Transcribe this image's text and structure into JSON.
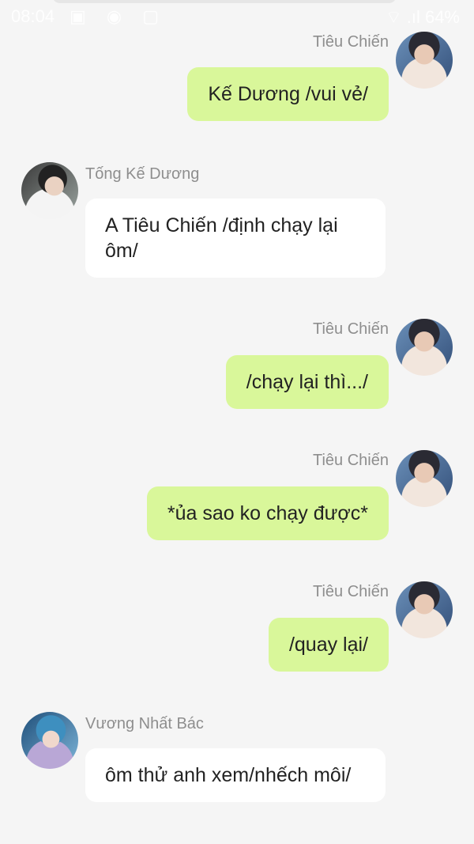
{
  "status_bar": {
    "time": "08:04",
    "icons": "▣ ◉ ▢",
    "battery": "⌔ .ıl 64%"
  },
  "messages": [
    {
      "sender": "Tiêu Chiến",
      "text": "Kế Dương /vui vẻ/",
      "direction": "out",
      "avatar": "avatar-tieu-chien"
    },
    {
      "sender": "Tống Kế Dương",
      "text": "A Tiêu Chiến /định chạy lại ôm/",
      "direction": "in",
      "avatar": "avatar-tong-ke-duong"
    },
    {
      "sender": "Tiêu Chiến",
      "text": "/chạy lại thì.../",
      "direction": "out",
      "avatar": "avatar-tieu-chien"
    },
    {
      "sender": "Tiêu Chiến",
      "text": "*ủa sao ko chạy được*",
      "direction": "out",
      "avatar": "avatar-tieu-chien"
    },
    {
      "sender": "Tiêu Chiến",
      "text": "/quay lại/",
      "direction": "out",
      "avatar": "avatar-tieu-chien"
    },
    {
      "sender": "Vương Nhất Bác",
      "text": "ôm thử anh xem/nhếch môi/",
      "direction": "in",
      "avatar": "avatar-vuong-nhat-bac"
    }
  ],
  "colors": {
    "background": "#f5f5f5",
    "outgoing_bubble": "#d9f79a",
    "incoming_bubble": "#ffffff",
    "sender_name": "#8e8e8e"
  }
}
